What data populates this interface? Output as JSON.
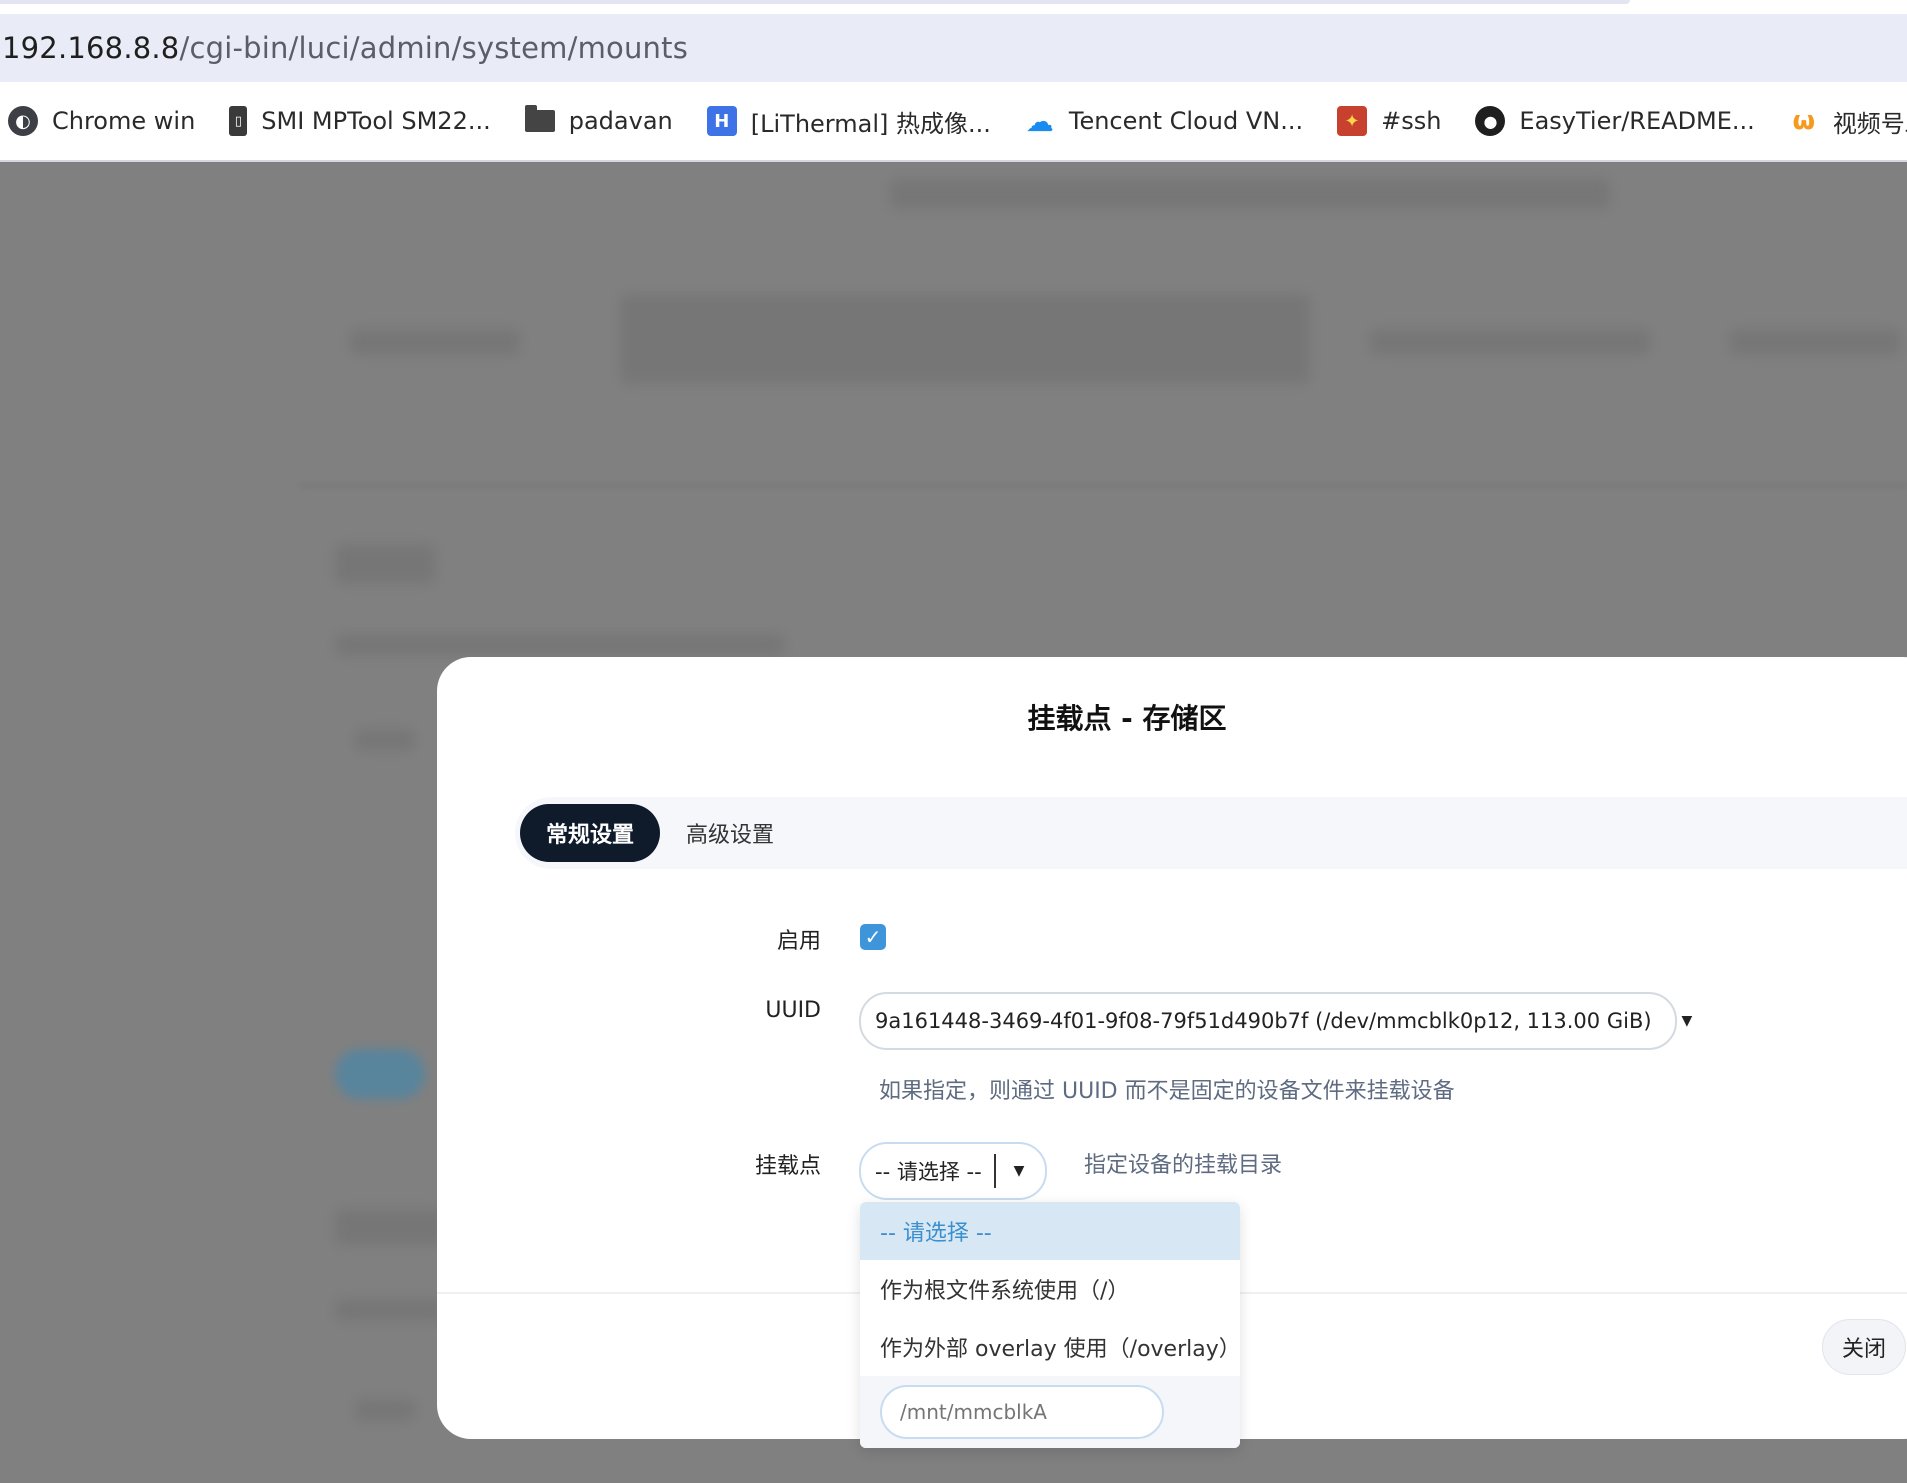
{
  "browser": {
    "address_host": "192.168.8.8",
    "address_path": "/cgi-bin/luci/admin/system/mounts",
    "bookmarks": [
      {
        "label": "Chrome win",
        "icon": "globe-icon"
      },
      {
        "label": "SMI MPTool SM22...",
        "icon": "usb-drive-icon"
      },
      {
        "label": "padavan",
        "icon": "folder-icon"
      },
      {
        "label": "[LiThermal] 热成像...",
        "icon": "lithermal-icon"
      },
      {
        "label": "Tencent Cloud VN...",
        "icon": "cloud-icon"
      },
      {
        "label": "#ssh",
        "icon": "ssh-icon"
      },
      {
        "label": "EasyTier/README...",
        "icon": "github-icon"
      },
      {
        "label": "视频号助手",
        "icon": "wechat-channels-icon"
      }
    ]
  },
  "modal": {
    "title": "挂载点 - 存储区",
    "tabs": [
      {
        "label": "常规设置",
        "active": true
      },
      {
        "label": "高级设置",
        "active": false
      }
    ],
    "enable": {
      "label": "启用",
      "checked": true
    },
    "uuid": {
      "label": "UUID",
      "value": "9a161448-3469-4f01-9f08-79f51d490b7f (/dev/mmcblk0p12, 113.00 GiB)",
      "hint": "如果指定，则通过 UUID 而不是固定的设备文件来挂载设备"
    },
    "mountpoint": {
      "label": "挂载点",
      "value": "-- 请选择 --",
      "hint": "指定设备的挂载目录",
      "options": [
        "-- 请选择 --",
        "作为根文件系统使用（/）",
        "作为外部 overlay 使用（/overlay）"
      ],
      "custom_placeholder": "/mnt/mmcblkA"
    },
    "close_label": "关闭"
  },
  "colors": {
    "accent": "#3f95d9",
    "active_tab": "#0f1a2b",
    "selected_option": "#d7e8f4"
  }
}
